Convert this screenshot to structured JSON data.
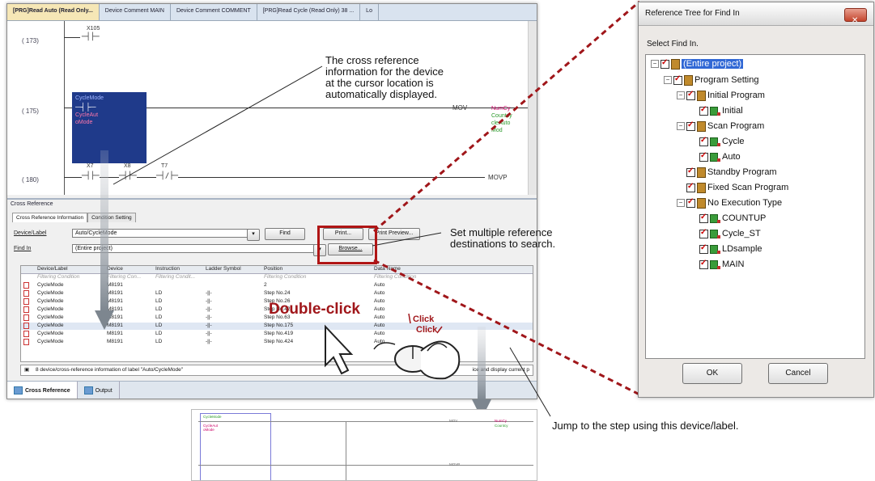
{
  "editor_tabs": [
    "[PRG]Read Auto (Read Only...",
    "Device Comment MAIN",
    "Device Comment COMMENT",
    "[PRG]Read Cycle (Read Only) 38 ...",
    "Lo"
  ],
  "ladder": {
    "steps": [
      "( 173)",
      "( 175)",
      "( 180)"
    ],
    "contact_x105": "X105",
    "contact_x7": "X7",
    "contact_x8": "X8",
    "contact_t7": "T7",
    "cursor_line1": "CycleMode",
    "cursor_line2": "CycleAut",
    "cursor_line3": "oMode",
    "cmd_mov": "MOV",
    "cmd_movp": "MOVP",
    "mov_operand1": "NumCy",
    "mov_operand2": "Countcy",
    "mov_operand3": "cleAuto",
    "mov_operand4": "Mod",
    "contact_symbol": "─┤├─",
    "contact_symbol_b": "─┤/├─"
  },
  "cross_ref": {
    "panel_title": "Cross Reference",
    "tab_info": "Cross Reference Information",
    "tab_condition": "Condition Setting",
    "device_label_caption": "Device/Label",
    "device_label_value": "Auto/CycleMode",
    "find_in_caption": "Find In",
    "find_in_value": "(Entire project)",
    "find_button": "Find",
    "print_button": "Print...",
    "print_preview_button": "Print Preview...",
    "browse_button": "Browse...",
    "columns": [
      "Device/Label",
      "Device",
      "Instruction",
      "Ladder Symbol",
      "Position",
      "Data Name"
    ],
    "filter_row": [
      "Filtering Condition",
      "Filtering Con...",
      "Filtering Condit...",
      "",
      "Filtering Condition",
      "Filtering Condition"
    ],
    "rows": [
      [
        "CycleMode",
        "M8191",
        "",
        "",
        "2",
        "Auto"
      ],
      [
        "CycleMode",
        "M8191",
        "LD",
        "-||-",
        "Step No.24",
        "Auto"
      ],
      [
        "CycleMode",
        "M8191",
        "LD",
        "-||-",
        "Step No.26",
        "Auto"
      ],
      [
        "CycleMode",
        "M8191",
        "LD",
        "-||-",
        "Step No.42",
        "Auto"
      ],
      [
        "CycleMode",
        "M8191",
        "LD",
        "-||-",
        "Step No.63",
        "Auto"
      ],
      [
        "CycleMode",
        "M8191",
        "LD",
        "-||-",
        "Step No.175",
        "Auto"
      ],
      [
        "CycleMode",
        "M8191",
        "LD",
        "-||-",
        "Step No.419",
        "Auto"
      ],
      [
        "CycleMode",
        "M8191",
        "LD",
        "-||-",
        "Step No.424",
        "Auto"
      ]
    ],
    "status_text": "8  device/cross-reference information of label \"Auto/CycleMode\"",
    "status_right": "ice and display current p"
  },
  "bottom_tabs": [
    "Cross Reference",
    "Output"
  ],
  "callouts": {
    "cursor_info": [
      "The cross reference",
      "information for the device",
      "at the cursor location is",
      "automatically displayed."
    ],
    "multi_dest": [
      "Set multiple reference",
      "destinations to search."
    ],
    "jump": "Jump to the step using this device/label.",
    "double_click": "Double-click",
    "click1": "Click",
    "click2": "Click"
  },
  "dialog": {
    "title": "Reference Tree for Find In",
    "close_glyph": "✕",
    "select_label": "Select Find In.",
    "ok": "OK",
    "cancel": "Cancel",
    "tree": {
      "root": "(Entire project)",
      "program_setting": "Program Setting",
      "initial_program": "Initial Program",
      "initial": "Initial",
      "scan_program": "Scan Program",
      "cycle": "Cycle",
      "auto": "Auto",
      "standby_program": "Standby Program",
      "fixed_scan_program": "Fixed Scan Program",
      "no_execution_type": "No Execution Type",
      "countup": "COUNTUP",
      "cycle_st": "Cycle_ST",
      "ldsample": "LDsample",
      "main": "MAIN"
    }
  },
  "colors": {
    "accent_red": "#a0161a",
    "cursor_blue": "#1f3a8a",
    "selection": "#3168d5"
  }
}
